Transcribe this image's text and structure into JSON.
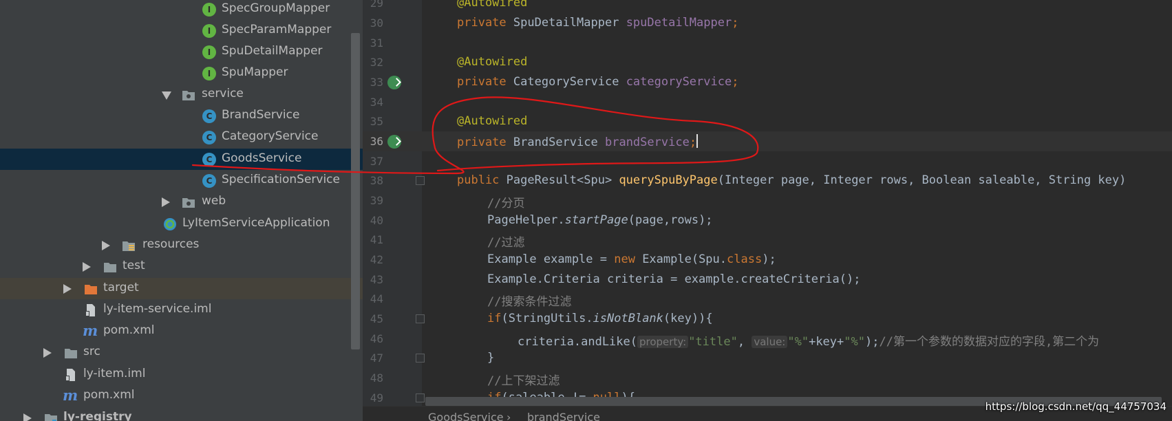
{
  "project_tree": {
    "items": [
      {
        "label": "SpecGroupMapper",
        "icon": "interface-icon"
      },
      {
        "label": "SpecParamMapper",
        "icon": "interface-icon"
      },
      {
        "label": "SpuDetailMapper",
        "icon": "interface-icon"
      },
      {
        "label": "SpuMapper",
        "icon": "interface-icon"
      },
      {
        "label": "service",
        "icon": "package-folder-icon"
      },
      {
        "label": "BrandService",
        "icon": "class-icon"
      },
      {
        "label": "CategoryService",
        "icon": "class-icon"
      },
      {
        "label": "GoodsService",
        "icon": "class-icon"
      },
      {
        "label": "SpecificationService",
        "icon": "class-icon"
      },
      {
        "label": "web",
        "icon": "package-folder-icon"
      },
      {
        "label": "LyItemServiceApplication",
        "icon": "spring-boot-class-icon"
      },
      {
        "label": "resources",
        "icon": "resources-folder-icon"
      },
      {
        "label": "test",
        "icon": "folder-icon"
      },
      {
        "label": "target",
        "icon": "excluded-folder-icon"
      },
      {
        "label": "ly-item-service.iml",
        "icon": "iml-file-icon"
      },
      {
        "label": "pom.xml",
        "icon": "maven-icon"
      },
      {
        "label": "src",
        "icon": "folder-icon"
      },
      {
        "label": "ly-item.iml",
        "icon": "iml-file-icon"
      },
      {
        "label": "pom.xml",
        "icon": "maven-icon"
      },
      {
        "label": "ly-registry",
        "icon": "module-folder-icon"
      }
    ],
    "selected": "GoodsService"
  },
  "editor": {
    "line_numbers": [
      "29",
      "30",
      "31",
      "32",
      "33",
      "34",
      "35",
      "36",
      "37",
      "38",
      "39",
      "40",
      "41",
      "42",
      "43",
      "44",
      "45",
      "46",
      "47",
      "48",
      "49"
    ],
    "current_line": "36",
    "tokens": {
      "autowired": "@Autowired",
      "private": "private",
      "public": "public",
      "new": "new",
      "if": "if",
      "class_kw": "class",
      "null_kw": "null",
      "spu_detail_mapper_type": "SpuDetailMapper",
      "spu_detail_mapper_field": "spuDetailMapper",
      "category_service_type": "CategoryService",
      "category_service_field": "categoryService",
      "brand_service_type": "BrandService",
      "brand_service_field": "brandService",
      "semicolon": ";",
      "page_result_sig": "PageResult<Spu> ",
      "method_name": "querySpuByPage",
      "params": "(Integer page, Integer rows, Boolean saleable, String key)",
      "comment_paging": "//分页",
      "pagehelper_obj": "PageHelper.",
      "start_page": "startPage",
      "start_page_args": "(page,rows);",
      "comment_filter": "//过滤",
      "example_decl": "Example example = ",
      "example_ctor": " Example(Spu.",
      "example_ctor_end": ");",
      "criteria_line": "Example.Criteria criteria = example.createCriteria();",
      "comment_search": "//搜索条件过滤",
      "if_open": "(StringUtils.",
      "is_not_blank": "isNotBlank",
      "is_not_blank_args": "(key)){",
      "and_like": "criteria.andLike(",
      "hint_property": "property:",
      "str_title": "\"title\"",
      "comma": ", ",
      "hint_value": "value:",
      "str_percent1": "\"%\"",
      "plus_key_plus": "+key+",
      "str_percent2": "\"%\"",
      "and_like_end": ");",
      "comment_first_param": "//第一个参数的数据对应的字段,第二个为",
      "close_brace": "}",
      "comment_onoff": "//上下架过滤",
      "if_saleable": "(saleable != ",
      "if_saleable_end": "){"
    }
  },
  "breadcrumb": {
    "class_name": "GoodsService",
    "separator": "›",
    "member": "brandService"
  },
  "watermark": "https://blog.csdn.net/qq_44757034"
}
